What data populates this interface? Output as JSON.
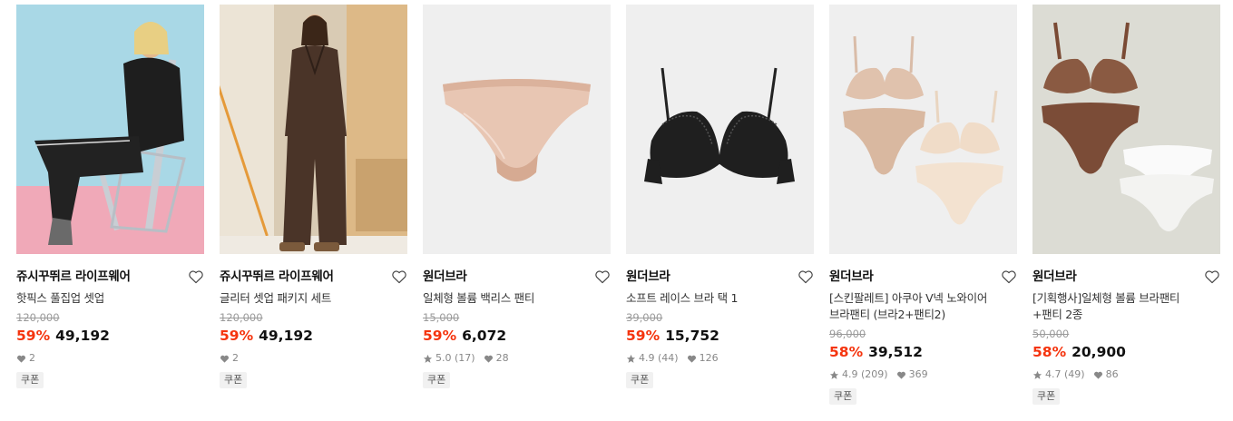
{
  "products": [
    {
      "brand": "쥬시꾸뛰르 라이프웨어",
      "name": "핫픽스 풀집업 셋업",
      "original_price": "120,000",
      "discount": "59%",
      "price": "49,192",
      "rating": "",
      "reviews": "",
      "likes": "2",
      "badge": "쿠폰"
    },
    {
      "brand": "쥬시꾸뛰르 라이프웨어",
      "name": "글리터 셋업 패키지 세트",
      "original_price": "120,000",
      "discount": "59%",
      "price": "49,192",
      "rating": "",
      "reviews": "",
      "likes": "2",
      "badge": "쿠폰"
    },
    {
      "brand": "원더브라",
      "name": "일체형 볼륨 백리스 팬티",
      "original_price": "15,000",
      "discount": "59%",
      "price": "6,072",
      "rating": "5.0",
      "reviews": "(17)",
      "likes": "28",
      "badge": "쿠폰"
    },
    {
      "brand": "원더브라",
      "name": "소프트 레이스 브라 택 1",
      "original_price": "39,000",
      "discount": "59%",
      "price": "15,752",
      "rating": "4.9",
      "reviews": "(44)",
      "likes": "126",
      "badge": "쿠폰"
    },
    {
      "brand": "원더브라",
      "name_line1": "[스킨팔레트] 아쿠아 V넥 노와이어",
      "name_line2": "브라팬티 (브라2+팬티2)",
      "original_price": "96,000",
      "discount": "58%",
      "price": "39,512",
      "rating": "4.9",
      "reviews": "(209)",
      "likes": "369",
      "badge": "쿠폰"
    },
    {
      "brand": "원더브라",
      "name_line1": "[기획행사]일체형 볼륨 브라팬티",
      "name_line2": "+팬티 2종",
      "original_price": "50,000",
      "discount": "58%",
      "price": "20,900",
      "rating": "4.7",
      "reviews": "(49)",
      "likes": "86",
      "badge": "쿠폰"
    }
  ],
  "colors": {
    "discount": "#f5340e",
    "strike": "#9a9a9a",
    "meta": "#888888"
  },
  "icons": {
    "wishlist": "heart-outline-icon",
    "rating": "star-icon",
    "likes": "heart-filled-icon"
  }
}
